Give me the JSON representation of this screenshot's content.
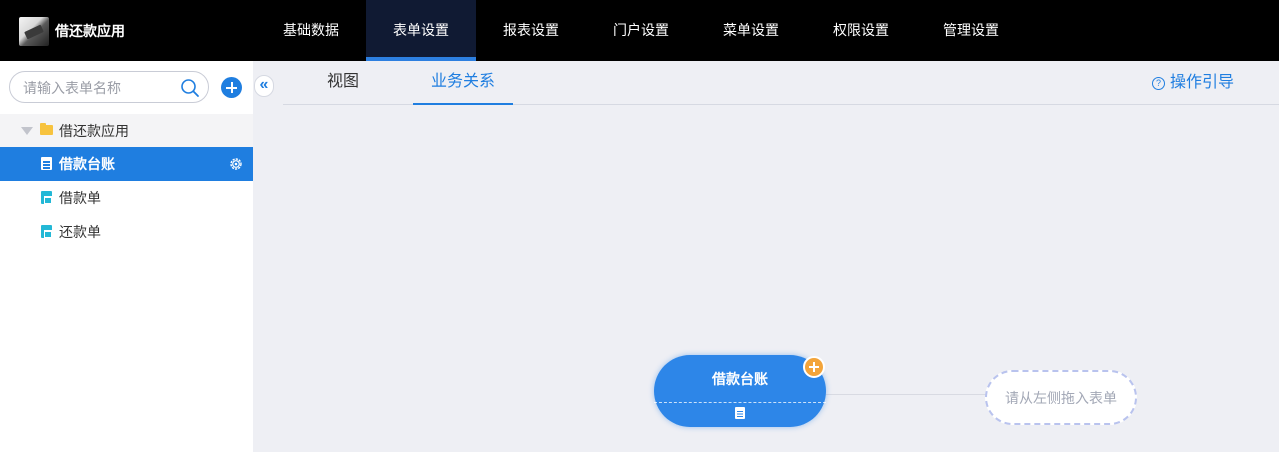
{
  "app": {
    "title": "借还款应用"
  },
  "nav": {
    "items": [
      "基础数据",
      "表单设置",
      "报表设置",
      "门户设置",
      "菜单设置",
      "权限设置",
      "管理设置"
    ],
    "active": "表单设置"
  },
  "sidebar": {
    "search_placeholder": "请输入表单名称",
    "tree": {
      "root_label": "借还款应用",
      "items": [
        {
          "label": "借款台账",
          "icon": "document-icon",
          "selected": true
        },
        {
          "label": "借款单",
          "icon": "form-icon",
          "selected": false
        },
        {
          "label": "还款单",
          "icon": "form-icon",
          "selected": false
        }
      ]
    }
  },
  "tabs": {
    "items": [
      "视图",
      "业务关系"
    ],
    "active": "业务关系"
  },
  "guide": {
    "label": "操作引导"
  },
  "canvas": {
    "main_node": {
      "title": "借款台账"
    },
    "drop_target": {
      "label": "请从左侧拖入表单"
    }
  },
  "colors": {
    "topbar": "#000000",
    "accent": "#1f7ee0",
    "add_badge": "#f3a43a",
    "canvas_bg": "#eeeff4"
  }
}
